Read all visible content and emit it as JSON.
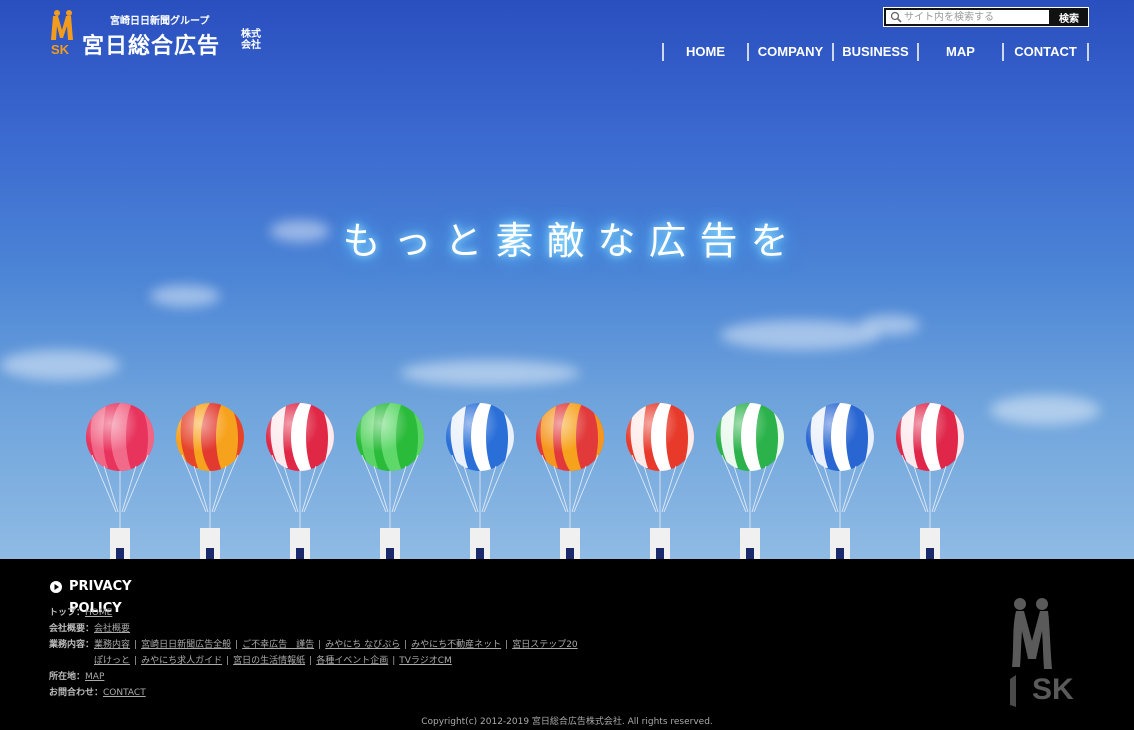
{
  "header": {
    "group_label": "宮崎日日新聞グループ",
    "company_name": "宮日総合広告",
    "company_suffix": "株式会社"
  },
  "search": {
    "placeholder": "サイト内を検索する",
    "button_label": "検索"
  },
  "nav": {
    "items": [
      "HOME",
      "COMPANY",
      "BUSINESS",
      "MAP",
      "CONTACT"
    ]
  },
  "hero": {
    "tagline": "もっと素敵な広告を",
    "balloon_colors": [
      [
        "#e8335d",
        "#f26a8a"
      ],
      [
        "#f7a21d",
        "#e23a2e"
      ],
      [
        "#e02846",
        "#ffffff"
      ],
      [
        "#2bbb3a",
        "#5fd86a"
      ],
      [
        "#2a6fd8",
        "#ffffff"
      ],
      [
        "#e23a3a",
        "#f7a21d"
      ],
      [
        "#e83a2a",
        "#ffffff"
      ],
      [
        "#2bb24a",
        "#ffffff"
      ],
      [
        "#2a66d2",
        "#ffffff"
      ],
      [
        "#e0274a",
        "#ffffff"
      ]
    ]
  },
  "footer": {
    "privacy_label": "PRIVACY POLICY",
    "top_label": "トップ：",
    "top_link": "HOME",
    "company_label": "会社概要：",
    "company_link": "会社概要",
    "business_label": "業務内容：",
    "business_links_1": [
      "業務内容",
      "宮崎日日新聞広告全般",
      "ご不幸広告　謹告",
      "みやにち なびぷら",
      "みやにち不動産ネット",
      "宮日ステップ20"
    ],
    "business_links_2": [
      "ぽけっと",
      "みやにち求人ガイド",
      "宮日の生活情報紙",
      "各種イベント企画",
      "TVラジオCM"
    ],
    "location_label": "所在地：",
    "location_link": "MAP",
    "contact_label": "お問合わせ：",
    "contact_link": "CONTACT",
    "copyright": "Copyright(c) 2012-2019 宮日総合広告株式会社. All rights reserved."
  }
}
